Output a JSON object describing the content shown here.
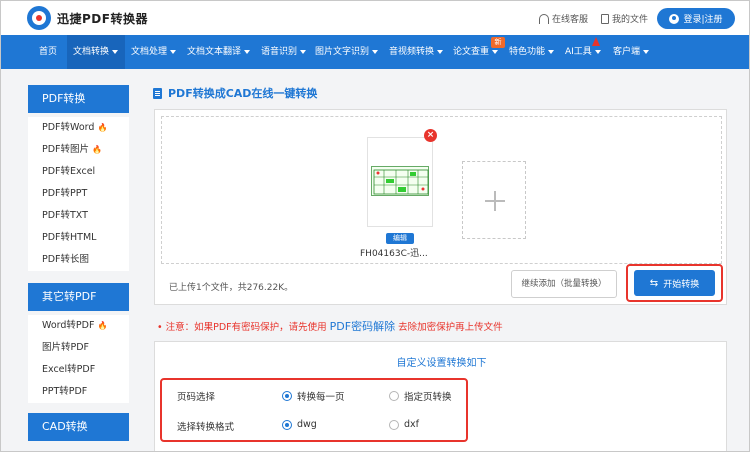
{
  "header": {
    "brand": "迅捷PDF转换器",
    "online_service": "在线客服",
    "my_files": "我的文件",
    "login": "登录|注册",
    "accent_color": "#1f77d4"
  },
  "nav": {
    "items": [
      {
        "label": "首页",
        "dropdown": false
      },
      {
        "label": "文档转换",
        "dropdown": true
      },
      {
        "label": "文档处理",
        "dropdown": true
      },
      {
        "label": "文档文本翻译",
        "dropdown": true
      },
      {
        "label": "语音识别",
        "dropdown": true
      },
      {
        "label": "图片文字识别",
        "dropdown": true
      },
      {
        "label": "音视频转换",
        "dropdown": true
      },
      {
        "label": "论文查重",
        "dropdown": true
      },
      {
        "label": "特色功能",
        "dropdown": true
      },
      {
        "label": "AI工具",
        "dropdown": true
      },
      {
        "label": "客户端",
        "dropdown": true
      }
    ],
    "active_index": 1,
    "new_badge": "新"
  },
  "sidebar": {
    "groups": [
      {
        "title": "PDF转换",
        "items": [
          {
            "label": "PDF转Word",
            "hot": true
          },
          {
            "label": "PDF转图片",
            "hot": true
          },
          {
            "label": "PDF转Excel",
            "hot": false
          },
          {
            "label": "PDF转PPT",
            "hot": false
          },
          {
            "label": "PDF转TXT",
            "hot": false
          },
          {
            "label": "PDF转HTML",
            "hot": false
          },
          {
            "label": "PDF转长图",
            "hot": false
          }
        ]
      },
      {
        "title": "其它转PDF",
        "items": [
          {
            "label": "Word转PDF",
            "hot": true
          },
          {
            "label": "图片转PDF",
            "hot": false
          },
          {
            "label": "Excel转PDF",
            "hot": false
          },
          {
            "label": "PPT转PDF",
            "hot": false
          }
        ]
      },
      {
        "title": "CAD转换",
        "items": []
      }
    ]
  },
  "main": {
    "title": "PDF转换成CAD在线一键转换",
    "file": {
      "name": "FH04163C-迅...",
      "edit_label": "编辑"
    },
    "upload_status": "已上传1个文件，共276.22K。",
    "continue_button": "继续添加（批量转换）",
    "start_button": "开始转换",
    "notice_before": "• 注意：如果PDF有密码保护，请先使用",
    "notice_link": "PDF密码解除",
    "notice_after": "去除加密保护再上传文件",
    "settings": {
      "title": "自定义设置转换如下",
      "page_label": "页码选择",
      "page_options": [
        "转换每一页",
        "指定页转换"
      ],
      "page_selected": 0,
      "format_label": "选择转换格式",
      "format_options": [
        "dwg",
        "dxf"
      ],
      "format_selected": 0
    }
  }
}
